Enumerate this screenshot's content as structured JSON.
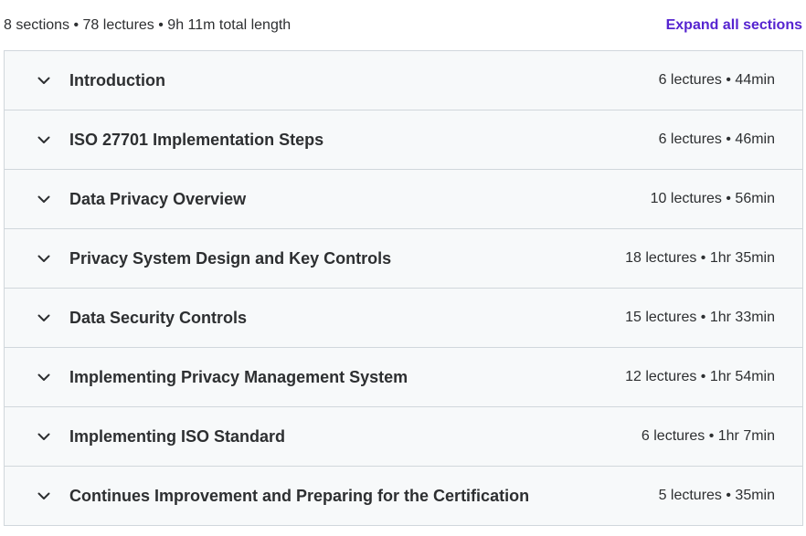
{
  "summary": {
    "text": "8 sections • 78 lectures • 9h 11m total length",
    "expand_all_label": "Expand all sections"
  },
  "sections": [
    {
      "title": "Introduction",
      "meta": "6 lectures • 44min"
    },
    {
      "title": "ISO 27701 Implementation Steps",
      "meta": "6 lectures • 46min"
    },
    {
      "title": "Data Privacy Overview",
      "meta": "10 lectures • 56min"
    },
    {
      "title": "Privacy System Design and Key Controls",
      "meta": "18 lectures • 1hr 35min"
    },
    {
      "title": "Data Security Controls",
      "meta": "15 lectures • 1hr 33min"
    },
    {
      "title": "Implementing Privacy Management System",
      "meta": "12 lectures • 1hr 54min"
    },
    {
      "title": "Implementing ISO Standard",
      "meta": "6 lectures • 1hr 7min"
    },
    {
      "title": "Continues Improvement and Preparing for the Certification",
      "meta": "5 lectures • 35min"
    }
  ],
  "icons": {
    "chevron": "chevron-down-icon"
  },
  "colors": {
    "accent": "#5624d0",
    "text": "#2d2f31",
    "row_bg": "#f7f9fa",
    "border": "#d1d7dc"
  }
}
